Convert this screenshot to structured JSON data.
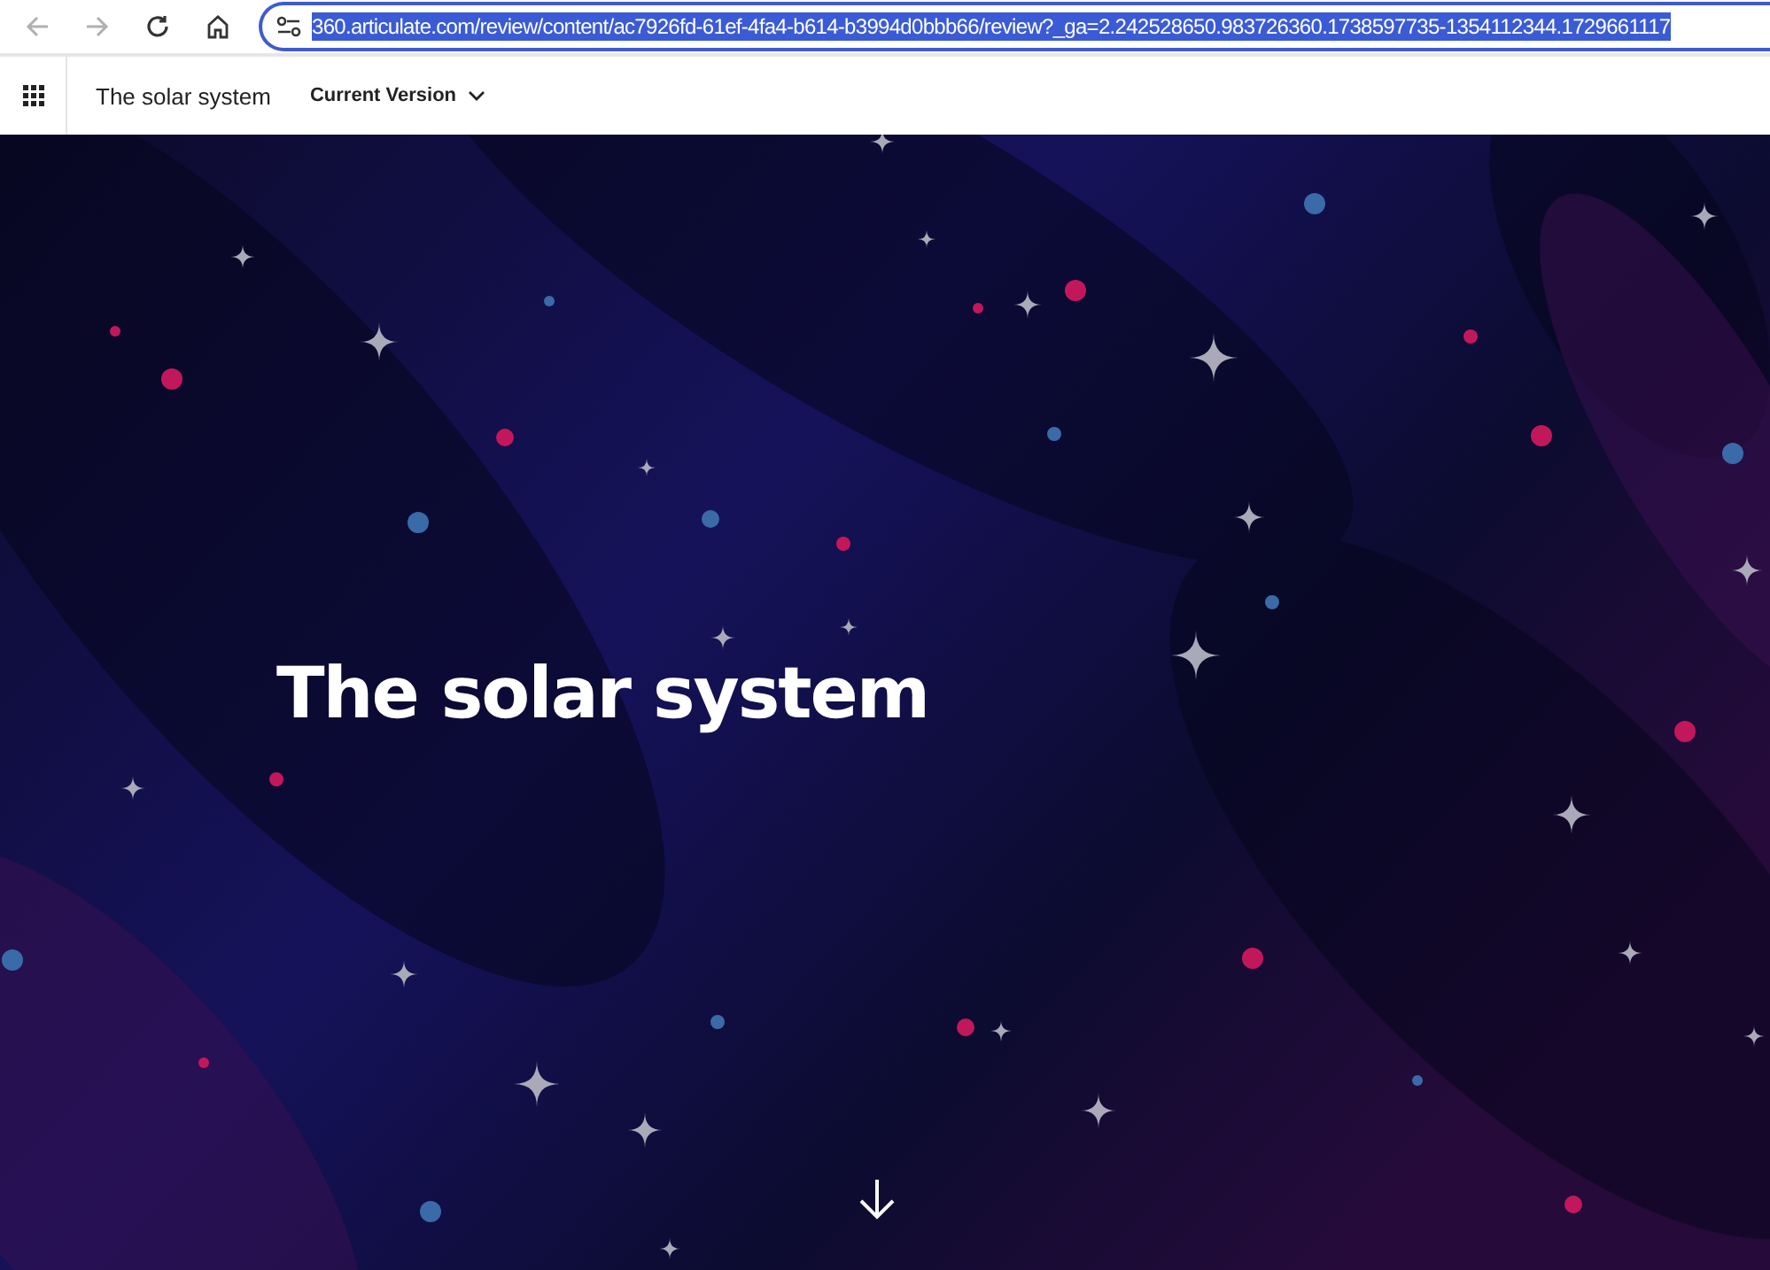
{
  "browser": {
    "url": "360.articulate.com/review/content/ac7926fd-61ef-4fa4-b614-b3994d0bbb66/review?_ga=2.242528650.983726360.1738597735-1354112344.1729661117",
    "url_selected": true
  },
  "header": {
    "title": "The solar system",
    "version_menu": "Current Version"
  },
  "hero": {
    "title": "The solar system"
  }
}
